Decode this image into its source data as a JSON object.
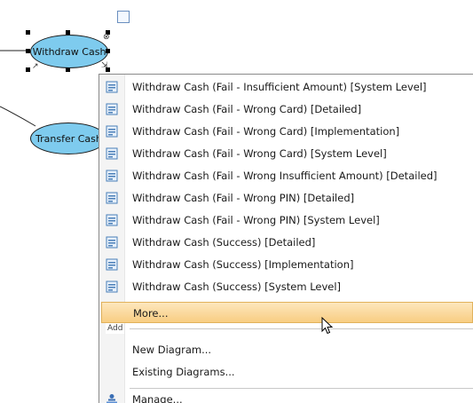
{
  "diagram": {
    "use_cases": [
      {
        "label": "Withdraw Cash"
      },
      {
        "label": "Transfer Cash"
      }
    ]
  },
  "menu": {
    "items": [
      {
        "label": "Withdraw Cash (Fail - Insufficient Amount) [System Level]",
        "icon": "diagram-icon"
      },
      {
        "label": "Withdraw Cash (Fail - Wrong Card) [Detailed]",
        "icon": "diagram-icon"
      },
      {
        "label": "Withdraw Cash (Fail - Wrong Card) [Implementation]",
        "icon": "diagram-icon"
      },
      {
        "label": "Withdraw Cash (Fail - Wrong Card) [System Level]",
        "icon": "diagram-icon"
      },
      {
        "label": "Withdraw Cash (Fail - Wrong Insufficient Amount) [Detailed]",
        "icon": "diagram-icon"
      },
      {
        "label": "Withdraw Cash (Fail - Wrong PIN) [Detailed]",
        "icon": "diagram-icon"
      },
      {
        "label": "Withdraw Cash (Fail - Wrong PIN) [System Level]",
        "icon": "diagram-icon"
      },
      {
        "label": "Withdraw Cash (Success) [Detailed]",
        "icon": "diagram-icon"
      },
      {
        "label": "Withdraw Cash (Success) [Implementation]",
        "icon": "diagram-icon"
      },
      {
        "label": "Withdraw Cash (Success) [System Level]",
        "icon": "diagram-icon"
      }
    ],
    "more_label": "More...",
    "add_section_label": "Add",
    "new_diagram_label": "New Diagram...",
    "existing_diagrams_label": "Existing Diagrams...",
    "manage_label": "Manage...",
    "manage_icon": "manage-icon"
  },
  "colors": {
    "use_case_fill": "#7ecbee",
    "highlight": "#f8cd82"
  }
}
